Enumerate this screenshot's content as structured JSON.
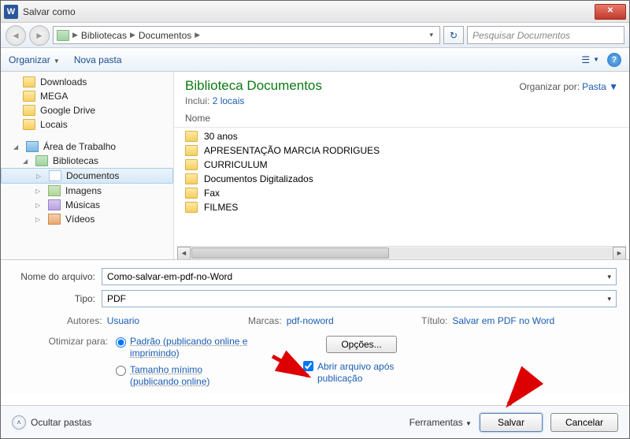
{
  "title": "Salvar como",
  "breadcrumbs": [
    "Bibliotecas",
    "Documentos"
  ],
  "search_placeholder": "Pesquisar Documentos",
  "toolbar": {
    "organize": "Organizar",
    "new_folder": "Nova pasta"
  },
  "sidebar": {
    "items": [
      {
        "label": "Downloads",
        "icon": "fold"
      },
      {
        "label": "MEGA",
        "icon": "fold"
      },
      {
        "label": "Google Drive",
        "icon": "fold"
      },
      {
        "label": "Locais",
        "icon": "fold"
      }
    ],
    "desktop": "Área de Trabalho",
    "libraries": "Bibliotecas",
    "lib_children": [
      {
        "label": "Documentos",
        "icon": "doc",
        "selected": true
      },
      {
        "label": "Imagens",
        "icon": "img"
      },
      {
        "label": "Músicas",
        "icon": "mus"
      },
      {
        "label": "Vídeos",
        "icon": "vid"
      }
    ]
  },
  "library": {
    "title": "Biblioteca Documentos",
    "subtitle_prefix": "Inclui: ",
    "subtitle_link": "2 locais",
    "arrange_label": "Organizar por:",
    "arrange_value": "Pasta"
  },
  "columns": {
    "name": "Nome"
  },
  "files": [
    "30 anos",
    "APRESENTAÇÃO MARCIA RODRIGUES",
    "CURRICULUM",
    "Documentos Digitalizados",
    "Fax",
    "FILMES"
  ],
  "form": {
    "filename_label": "Nome do arquivo:",
    "filename_value": "Como-salvar-em-pdf-no-Word",
    "type_label": "Tipo:",
    "type_value": "PDF",
    "authors_label": "Autores:",
    "authors_value": "Usuario",
    "tags_label": "Marcas:",
    "tags_value": "pdf-noword",
    "doc_title_label": "Título:",
    "doc_title_value": "Salvar em PDF no Word",
    "optimize_label": "Otimizar para:",
    "opt_standard": "Padrão (publicando online e imprimindo)",
    "opt_minimum": "Tamanho mínimo (publicando online)",
    "options_btn": "Opções...",
    "open_after_label": "Abrir arquivo após publicação"
  },
  "footer": {
    "hide_folders": "Ocultar pastas",
    "tools": "Ferramentas",
    "save": "Salvar",
    "cancel": "Cancelar"
  }
}
